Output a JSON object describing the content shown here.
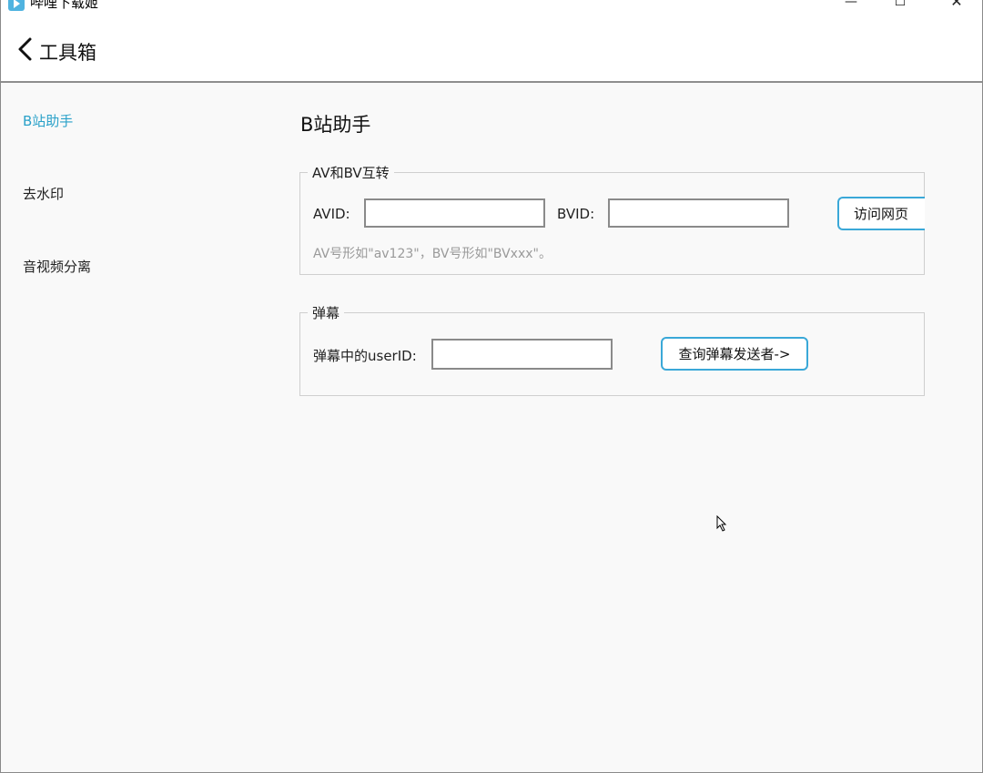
{
  "window": {
    "app_title": "哔哩下载姬",
    "minimize_glyph": "—",
    "maximize_glyph": "☐",
    "close_glyph": "✕"
  },
  "header": {
    "back_icon": "chevron-left-icon",
    "title": "工具箱"
  },
  "sidebar": {
    "items": [
      {
        "label": "B站助手",
        "active": true
      },
      {
        "label": "去水印",
        "active": false
      },
      {
        "label": "音视频分离",
        "active": false
      }
    ]
  },
  "main": {
    "title": "B站助手",
    "av_bv_group": {
      "legend": "AV和BV互转",
      "avid_label": "AVID:",
      "avid_value": "",
      "bvid_label": "BVID:",
      "bvid_value": "",
      "visit_button": "访问网页",
      "hint": "AV号形如\"av123\"，BV号形如\"BVxxx\"。"
    },
    "danmaku_group": {
      "legend": "弹幕",
      "userid_label": "弹幕中的userID:",
      "userid_value": "",
      "query_button": "查询弹幕发送者->"
    }
  },
  "colors": {
    "accent": "#2aa1c9",
    "button_border": "#3aa8d8"
  }
}
